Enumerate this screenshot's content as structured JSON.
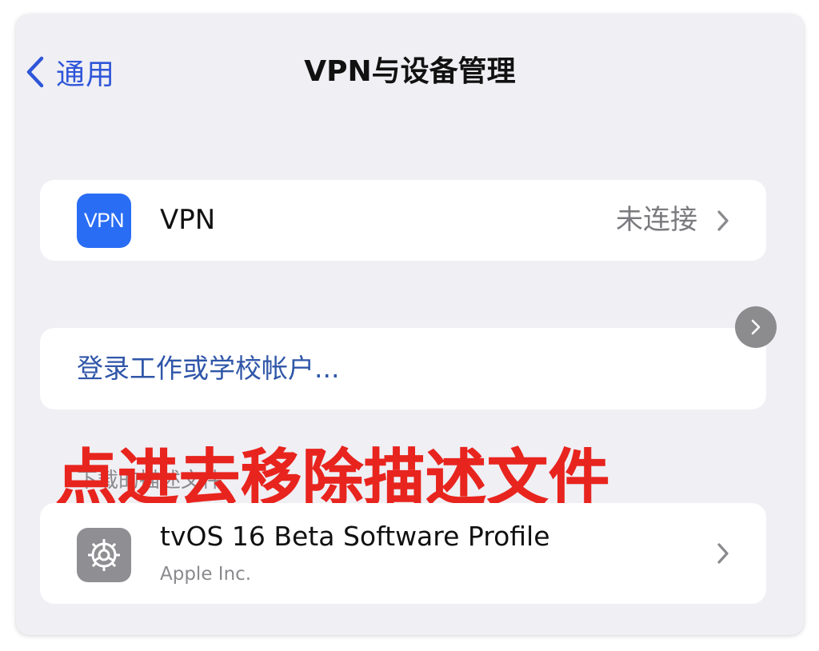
{
  "nav": {
    "back_label": "通用",
    "title": "VPN与设备管理"
  },
  "vpn_row": {
    "icon_text": "VPN",
    "label": "VPN",
    "status": "未连接"
  },
  "login_row": {
    "label": "登录工作或学校帐户..."
  },
  "section": {
    "header": "下载的描述文件"
  },
  "overlay": {
    "text": "点进去移除描述文件"
  },
  "profile_row": {
    "name": "tvOS 16 Beta Software Profile",
    "org": "Apple Inc."
  },
  "colors": {
    "accent": "#2f56d8",
    "vpn_icon_bg": "#2a6df5",
    "overlay_text": "#e8241e",
    "background": "#efeff4"
  },
  "icons": {
    "back": "chevron-left-icon",
    "row_disclosure": "chevron-right-icon",
    "profile": "gear-icon",
    "floating": "chevron-right-icon"
  }
}
